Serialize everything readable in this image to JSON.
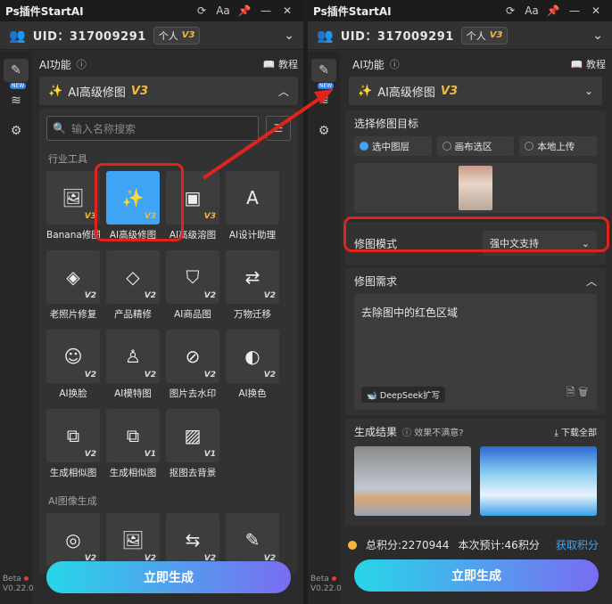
{
  "app": {
    "title": "Ps插件StartAI",
    "beta_label": "Beta",
    "version": "V0.22.0"
  },
  "titlebar_icons": [
    "refresh-icon",
    "font-size-icon",
    "pin-icon",
    "minimize-icon",
    "close-icon"
  ],
  "titlebar_icon_glyphs": [
    "⟳",
    "Aa",
    "📌",
    "—",
    "✕"
  ],
  "account": {
    "uid_text": "UID：317009291",
    "plan": "个人",
    "plan_version": "V3"
  },
  "left": {
    "section_title": "AI功能",
    "tutorial_label": "教程",
    "selected_function": "AI高级修图",
    "selected_version": "V3",
    "search_placeholder": "输入名称搜索",
    "category_industry": "行业工具",
    "tiles": [
      {
        "label": "Banana修图",
        "version": "V3",
        "gold": true,
        "icon": "image-edit-icon",
        "glyph": "🖼"
      },
      {
        "label": "AI高级修图",
        "version": "V3",
        "gold": true,
        "icon": "magic-wand-icon",
        "glyph": "✨",
        "selected": true
      },
      {
        "label": "AI高级溶图",
        "version": "V3",
        "gold": true,
        "icon": "image-blend-icon",
        "glyph": "▣"
      },
      {
        "label": "AI设计助理",
        "version": "",
        "gold": true,
        "icon": "design-assistant-icon",
        "glyph": "A"
      },
      {
        "label": "老照片修复",
        "version": "V2",
        "gold": false,
        "icon": "photo-repair-icon",
        "glyph": "◈"
      },
      {
        "label": "产品精修",
        "version": "V2",
        "gold": false,
        "icon": "diamond-icon",
        "glyph": "◇"
      },
      {
        "label": "AI商品图",
        "version": "V2",
        "gold": false,
        "icon": "shopping-bag-icon",
        "glyph": "⛉"
      },
      {
        "label": "万物迁移",
        "version": "V2",
        "gold": false,
        "icon": "transfer-icon",
        "glyph": "⇄"
      },
      {
        "label": "AI换脸",
        "version": "V2",
        "gold": false,
        "icon": "face-swap-icon",
        "glyph": "☺"
      },
      {
        "label": "AI模特图",
        "version": "V2",
        "gold": false,
        "icon": "model-icon",
        "glyph": "♙"
      },
      {
        "label": "图片去水印",
        "version": "V2",
        "gold": false,
        "icon": "watermark-remove-icon",
        "glyph": "⊘"
      },
      {
        "label": "AI换色",
        "version": "V2",
        "gold": false,
        "icon": "recolor-icon",
        "glyph": "◐"
      },
      {
        "label": "生成相似图",
        "version": "V2",
        "gold": false,
        "icon": "similar-image-icon",
        "glyph": "⧉"
      },
      {
        "label": "生成相似图",
        "version": "V1",
        "gold": false,
        "icon": "similar-image-v1-icon",
        "glyph": "⧉"
      },
      {
        "label": "抠图去背景",
        "version": "V1",
        "gold": false,
        "icon": "cutout-icon",
        "glyph": "▨"
      }
    ],
    "category_image_gen": "AI图像生成",
    "gen_tiles": [
      {
        "version": "V2",
        "icon": "swirl-icon",
        "glyph": "◎"
      },
      {
        "version": "V2",
        "icon": "image-text-icon",
        "glyph": "🖼"
      },
      {
        "version": "V2",
        "icon": "image-swap-icon",
        "glyph": "⇆"
      },
      {
        "version": "V2",
        "icon": "sketch-icon",
        "glyph": "✎"
      }
    ],
    "generate_label": "立即生成"
  },
  "right": {
    "section_title": "AI功能",
    "tutorial_label": "教程",
    "selected_function": "AI高级修图",
    "selected_version": "V3",
    "target_title": "选择修图目标",
    "target_options": [
      "选中图层",
      "画布选区",
      "本地上传"
    ],
    "target_selected": "选中图层",
    "mode_label": "修图模式",
    "mode_value": "强中文支持",
    "request_title": "修图需求",
    "request_text": "去除图中的红色区域",
    "deepseek_label": "DeepSeek扩写",
    "results_title": "生成结果",
    "results_feedback": "效果不满意?",
    "download_all": "下载全部",
    "total_credits": "总积分:2270944",
    "estimate": "本次预计:46积分",
    "get_credits": "获取积分",
    "generate_label": "立即生成"
  },
  "colors": {
    "accent": "#3ea4f5",
    "highlight": "#e0241b",
    "gold": "#f2b93b"
  }
}
